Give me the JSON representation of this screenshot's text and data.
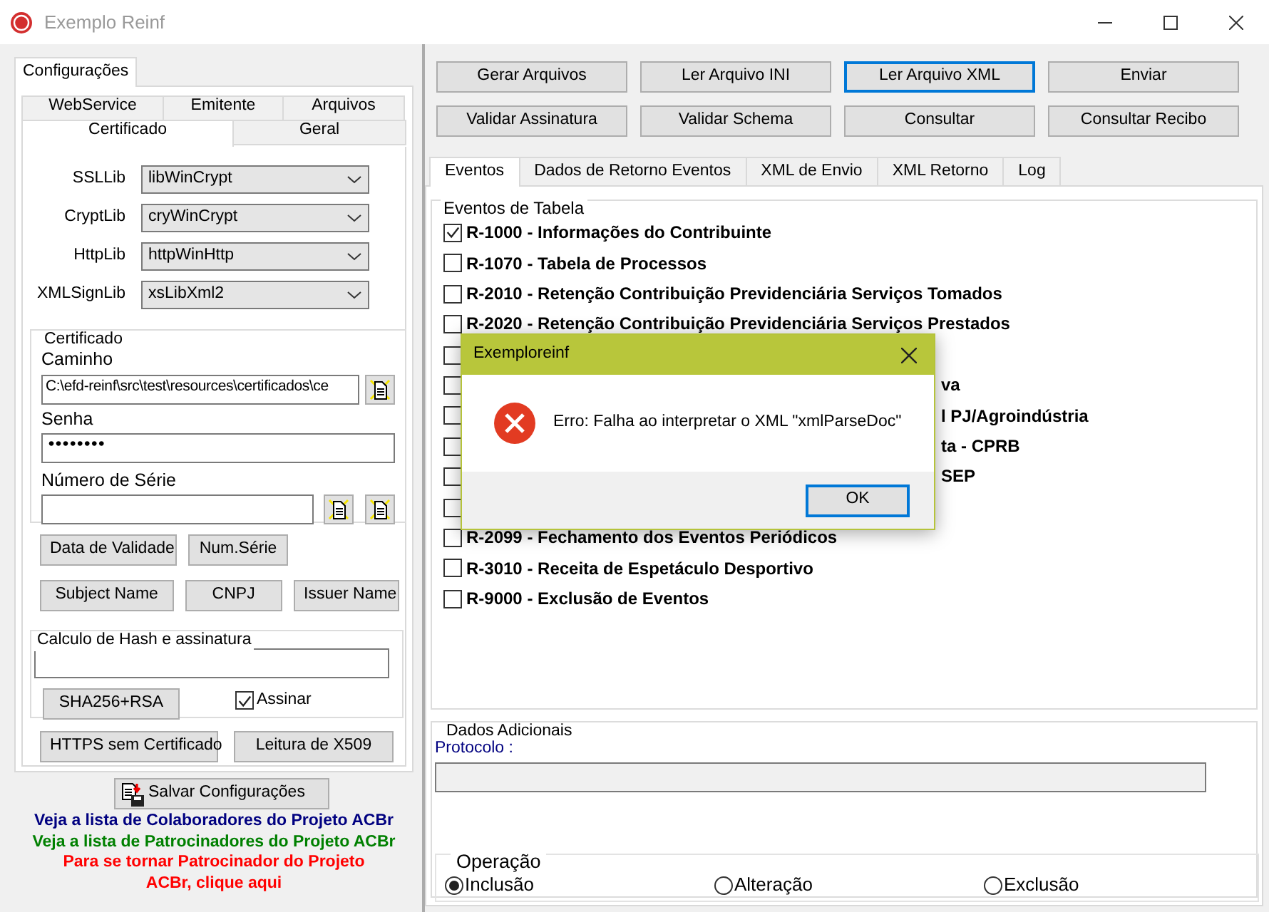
{
  "window": {
    "title": "Exemplo Reinf"
  },
  "config_tab": {
    "label": "Configurações",
    "selected": true
  },
  "tab_rows": [
    [
      {
        "label": "WebService",
        "selected": false
      },
      {
        "label": "Emitente",
        "selected": false
      },
      {
        "label": "Arquivos",
        "selected": false
      }
    ],
    [
      {
        "label": "Certificado",
        "selected": true
      },
      {
        "label": "Geral",
        "selected": false
      }
    ]
  ],
  "libs": [
    {
      "label": "SSLLib",
      "value": "libWinCrypt"
    },
    {
      "label": "CryptLib",
      "value": "cryWinCrypt"
    },
    {
      "label": "HttpLib",
      "value": "httpWinHttp"
    },
    {
      "label": "XMLSignLib",
      "value": "xsLibXml2"
    }
  ],
  "certificado": {
    "title": "Certificado",
    "caminho_label": "Caminho",
    "caminho_value": "C:\\efd-reinf\\src\\test\\resources\\certificados\\ce",
    "senha_label": "Senha",
    "senha_value": "••••••••",
    "numero_serie_label": "Número de Série"
  },
  "cert_buttons": [
    [
      "Data de Validade",
      "Num.Série"
    ],
    [
      "Subject Name",
      "CNPJ",
      "Issuer Name"
    ]
  ],
  "hash": {
    "title": "Calculo de Hash e assinatura",
    "button": "SHA256+RSA",
    "assinar": {
      "label": "Assinar",
      "checked": true
    }
  },
  "bottom_buttons": [
    "HTTPS sem Certificado",
    "Leitura de X509"
  ],
  "save_button": "Salvar Configurações",
  "links": [
    {
      "text": "Veja a lista de Colaboradores do Projeto ACBr",
      "color": "#000080"
    },
    {
      "text": "Veja a lista de Patrocinadores do Projeto ACBr",
      "color": "#008000"
    },
    {
      "text": "Para se tornar Patrocinador do Projeto ACBr, clique aqui",
      "color": "#ff0000"
    }
  ],
  "actions": [
    [
      {
        "label": "Gerar Arquivos",
        "focused": false
      },
      {
        "label": "Ler Arquivo INI",
        "focused": false
      },
      {
        "label": "Ler Arquivo XML",
        "focused": true
      },
      {
        "label": "Enviar",
        "focused": false
      }
    ],
    [
      {
        "label": "Validar Assinatura",
        "focused": false
      },
      {
        "label": "Validar Schema",
        "focused": false
      },
      {
        "label": "Consultar",
        "focused": false
      },
      {
        "label": "Consultar Recibo",
        "focused": false
      }
    ]
  ],
  "tabs": [
    {
      "label": "Eventos",
      "selected": true
    },
    {
      "label": "Dados de Retorno Eventos",
      "selected": false
    },
    {
      "label": "XML de Envio",
      "selected": false
    },
    {
      "label": "XML Retorno",
      "selected": false
    },
    {
      "label": "Log",
      "selected": false
    }
  ],
  "eventos_tabela": {
    "title": "Eventos de Tabela",
    "items": [
      {
        "kind": "full",
        "label": "R-1000 - Informações do Contribuinte",
        "checked": true
      },
      {
        "kind": "full",
        "label": "R-1070 - Tabela de Processos",
        "checked": false
      },
      {
        "kind": "full",
        "label": "R-2010 - Retenção Contribuição Previdenciária  Serviços Tomados",
        "checked": false
      },
      {
        "kind": "full",
        "label": "R-2020 - Retenção Contribuição Previdenciária  Serviços Prestados",
        "checked": false
      },
      {
        "kind": "covered",
        "checked": false
      },
      {
        "kind": "partial",
        "label": "va",
        "checked": false
      },
      {
        "kind": "partial",
        "label": "l PJ/Agroindústria",
        "checked": false
      },
      {
        "kind": "partial",
        "label": "ta - CPRB",
        "checked": false
      },
      {
        "kind": "partial",
        "label": "SEP",
        "checked": false
      },
      {
        "kind": "covered",
        "checked": false
      },
      {
        "kind": "full",
        "label": "R-2099 - Fechamento dos Eventos Periódicos",
        "checked": false
      },
      {
        "kind": "full",
        "label": "R-3010 - Receita de Espetáculo Desportivo",
        "checked": false
      },
      {
        "kind": "full",
        "label": "R-9000 - Exclusão de Eventos",
        "checked": false
      }
    ]
  },
  "dados_adicionais": {
    "title": "Dados Adicionais",
    "protocolo_label": "Protocolo :"
  },
  "operacao": {
    "title": "Operação",
    "options": [
      {
        "label": "Inclusão",
        "selected": true
      },
      {
        "label": "Alteração",
        "selected": false
      },
      {
        "label": "Exclusão",
        "selected": false
      }
    ]
  },
  "dialog": {
    "title": "Exemploreinf",
    "message": "Erro: Falha ao interpretar o XML \"xmlParseDoc\"",
    "button": "OK"
  }
}
